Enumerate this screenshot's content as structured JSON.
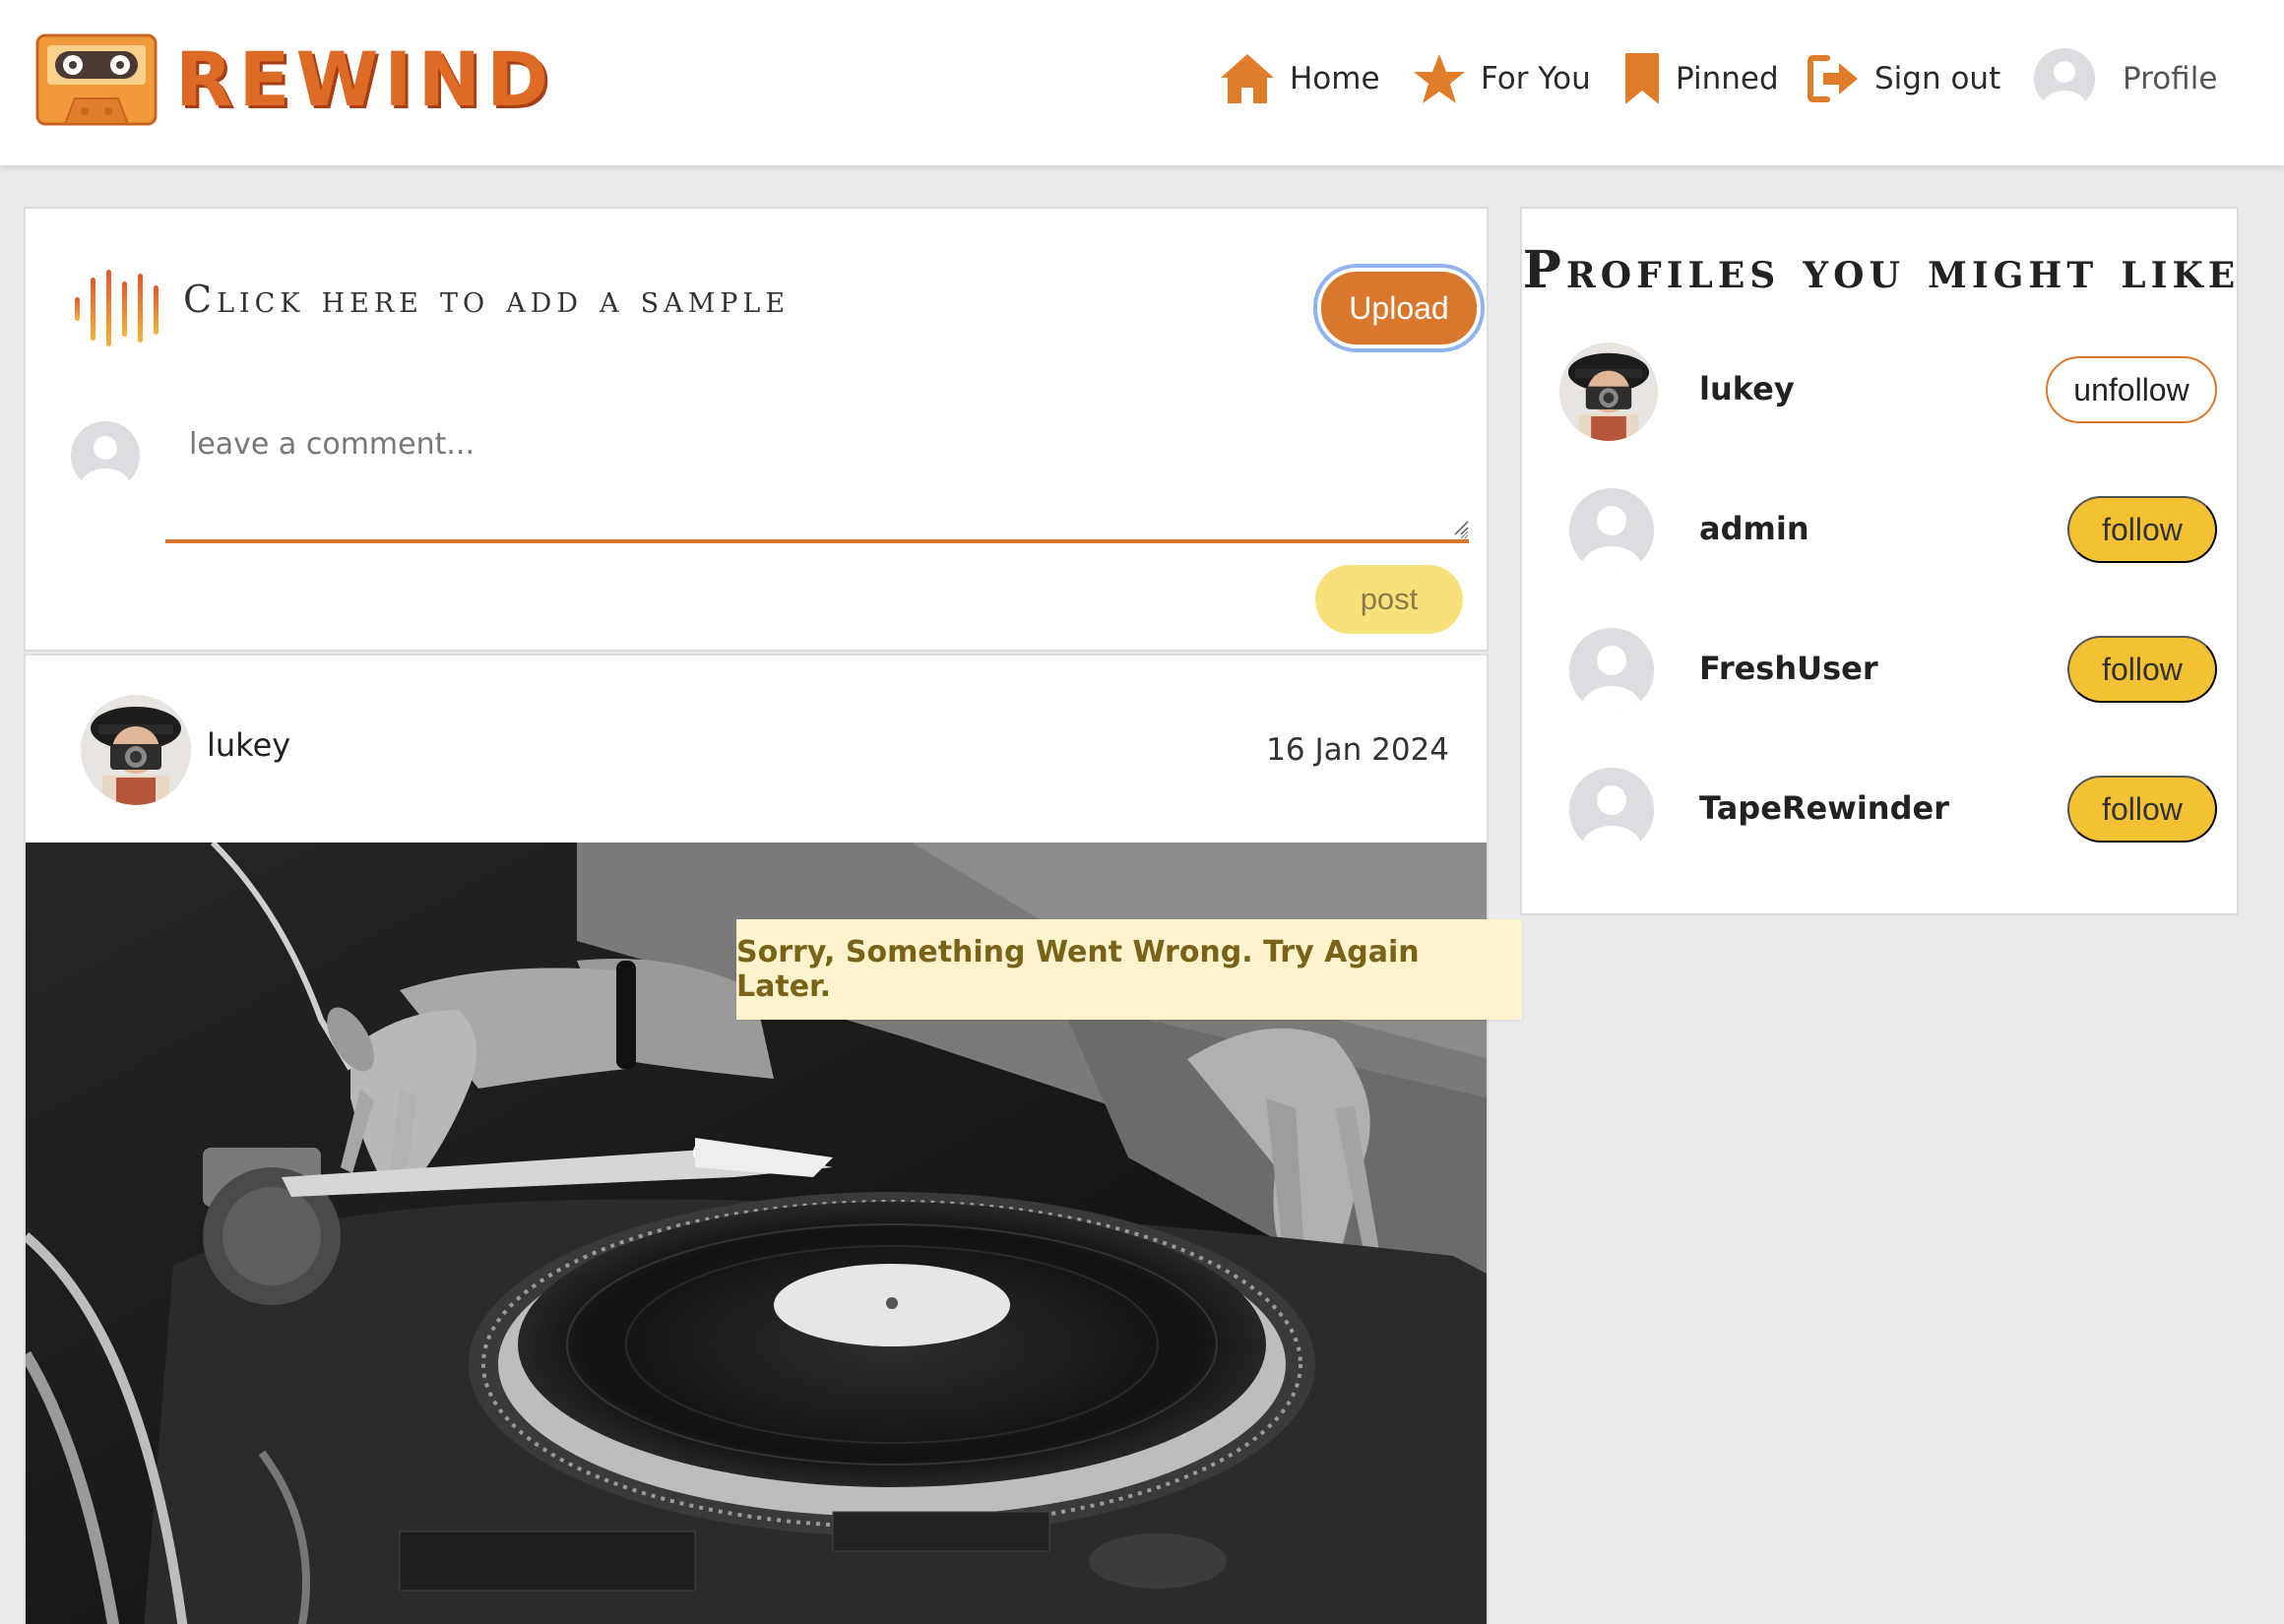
{
  "brand": {
    "name": "REWIND"
  },
  "nav": {
    "home": "Home",
    "for_you": "For You",
    "pinned": "Pinned",
    "sign_out": "Sign out",
    "profile": "Profile"
  },
  "composer": {
    "sample_prompt": "Click here to add a sample",
    "upload_label": "Upload",
    "comment_placeholder": "leave a comment...",
    "post_label": "post"
  },
  "post": {
    "username": "lukey",
    "date": "16 Jan 2024"
  },
  "toast": {
    "message": "Sorry, Something Went Wrong. Try Again Later."
  },
  "sidebar": {
    "title": "Profiles you might like",
    "profiles": [
      {
        "name": "lukey",
        "action": "unfollow"
      },
      {
        "name": "admin",
        "action": "follow"
      },
      {
        "name": "FreshUser",
        "action": "follow"
      },
      {
        "name": "TapeRewinder",
        "action": "follow"
      }
    ]
  },
  "colors": {
    "accent": "#d9782d",
    "follow": "#f4c133",
    "post_button": "#f8e07a",
    "toast_bg": "#fdf3cc",
    "toast_text": "#7a6318"
  },
  "icons": {
    "home": "home-icon",
    "for_you": "star-icon",
    "pinned": "bookmark-icon",
    "sign_out": "sign-out-icon",
    "profile": "user-avatar-icon",
    "sample": "sound-wave-icon"
  }
}
